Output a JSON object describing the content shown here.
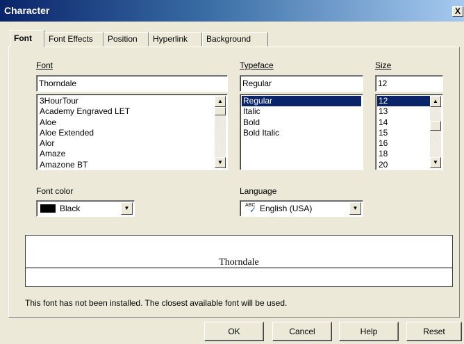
{
  "window": {
    "title": "Character",
    "close_label": "X"
  },
  "tabs": [
    {
      "label": "Font",
      "active": true
    },
    {
      "label": "Font Effects",
      "active": false
    },
    {
      "label": "Position",
      "active": false
    },
    {
      "label": "Hyperlink",
      "active": false
    },
    {
      "label": "Background",
      "active": false
    }
  ],
  "font": {
    "label": "Font",
    "value": "Thorndale",
    "items": [
      "3HourTour",
      "Academy Engraved LET",
      "Aloe",
      "Aloe Extended",
      "Alor",
      "Amaze",
      "Amazone BT"
    ]
  },
  "typeface": {
    "label": "Typeface",
    "value": "Regular",
    "items": [
      "Regular",
      "Italic",
      "Bold",
      "Bold Italic"
    ],
    "selected_index": 0
  },
  "size": {
    "label": "Size",
    "value": "12",
    "items": [
      "12",
      "13",
      "14",
      "15",
      "16",
      "18",
      "20"
    ],
    "selected_index": 0
  },
  "font_color": {
    "label": "Font color",
    "value": "Black",
    "swatch": "#000000"
  },
  "language": {
    "label": "Language",
    "value": "English (USA)",
    "icon_text": "ABC"
  },
  "preview": {
    "text": "Thorndale"
  },
  "note": "This font has not been installed. The closest available font will be used.",
  "buttons": {
    "ok": "OK",
    "cancel": "Cancel",
    "help": "Help",
    "reset": "Reset"
  },
  "colors": {
    "selection": "#0a246a",
    "dialog_bg": "#ece9d8",
    "title_bar": "#0a246a"
  }
}
